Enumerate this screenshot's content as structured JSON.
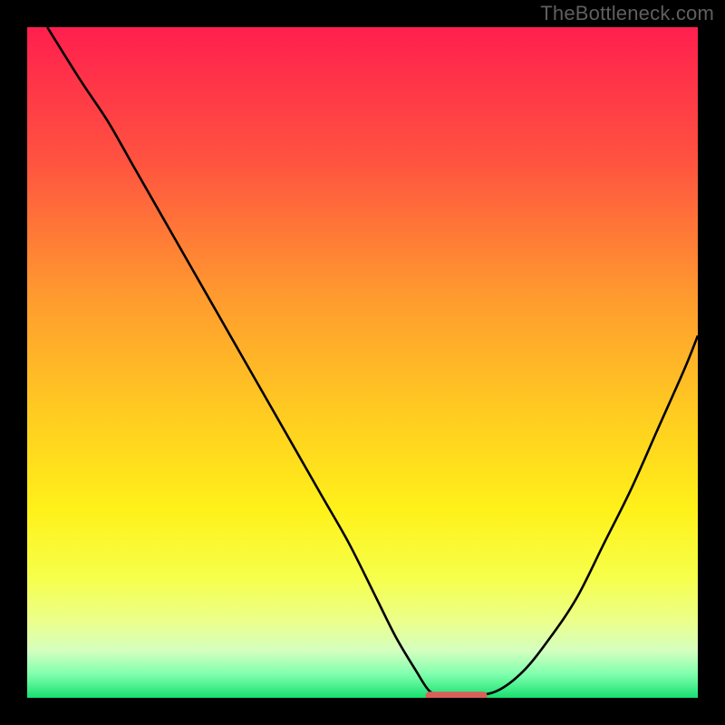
{
  "watermark": "TheBottleneck.com",
  "colors": {
    "frame": "#000000",
    "watermark_text": "#5f5f5f",
    "curve": "#000000",
    "flat_marker": "#d9605a",
    "gradient_stops": [
      {
        "offset": 0.0,
        "color": "#ff1f4e"
      },
      {
        "offset": 0.2,
        "color": "#ff5340"
      },
      {
        "offset": 0.4,
        "color": "#ff9a2f"
      },
      {
        "offset": 0.6,
        "color": "#ffd21f"
      },
      {
        "offset": 0.72,
        "color": "#fff11a"
      },
      {
        "offset": 0.82,
        "color": "#f6ff4a"
      },
      {
        "offset": 0.885,
        "color": "#ecff8a"
      },
      {
        "offset": 0.93,
        "color": "#d4ffc0"
      },
      {
        "offset": 0.965,
        "color": "#7fffad"
      },
      {
        "offset": 1.0,
        "color": "#18e070"
      }
    ]
  },
  "chart_data": {
    "type": "line",
    "title": "",
    "xlabel": "",
    "ylabel": "",
    "xlim": [
      0,
      100
    ],
    "ylim": [
      0,
      100
    ],
    "x": [
      3,
      8,
      12,
      16,
      20,
      24,
      28,
      32,
      36,
      40,
      44,
      48,
      52,
      55,
      58,
      60,
      62,
      66,
      70,
      74,
      78,
      82,
      86,
      90,
      94,
      98,
      100
    ],
    "values": [
      100,
      92,
      86,
      79,
      72,
      65,
      58,
      51,
      44,
      37,
      30,
      23,
      15,
      9,
      4,
      1,
      0.3,
      0.3,
      1,
      4,
      9,
      15,
      23,
      31,
      40,
      49,
      54
    ],
    "flat_segment": {
      "x_start": 60,
      "x_end": 68,
      "y": 0.3
    }
  }
}
